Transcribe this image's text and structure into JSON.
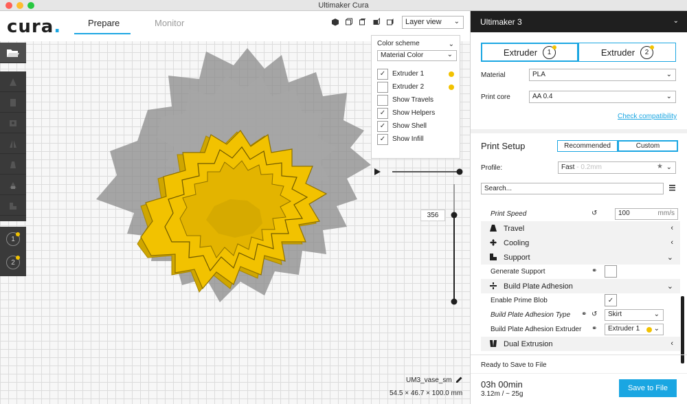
{
  "window": {
    "title": "Ultimaker Cura"
  },
  "header": {
    "logo": "cura",
    "tabs": [
      {
        "label": "Prepare"
      },
      {
        "label": "Monitor"
      }
    ],
    "view_mode": "Layer view"
  },
  "view_icons": [
    "iso-view-icon",
    "front-view-icon",
    "top-view-icon",
    "left-view-icon",
    "right-view-icon"
  ],
  "tools": [
    {
      "name": "open-file-icon"
    },
    {
      "name": "move-tool-icon"
    },
    {
      "name": "scale-tool-icon"
    },
    {
      "name": "rotate-tool-icon"
    },
    {
      "name": "mirror-tool-icon"
    },
    {
      "name": "per-model-settings-icon"
    },
    {
      "name": "support-blocker-icon"
    }
  ],
  "extruder_badges": [
    "1",
    "2"
  ],
  "color_panel": {
    "title": "Color scheme",
    "scheme": "Material Color",
    "options": [
      {
        "label": "Extruder 1",
        "checked": true,
        "dot": true
      },
      {
        "label": "Extruder 2",
        "checked": false,
        "dot": true
      },
      {
        "label": "Show Travels",
        "checked": false,
        "dot": false
      },
      {
        "label": "Show Helpers",
        "checked": true,
        "dot": false
      },
      {
        "label": "Show Shell",
        "checked": true,
        "dot": false
      },
      {
        "label": "Show Infill",
        "checked": true,
        "dot": false
      }
    ]
  },
  "layer": {
    "current": "356"
  },
  "model": {
    "name": "UM3_vase_sm",
    "dimensions": "54.5 × 46.7 × 100.0 mm"
  },
  "sidebar": {
    "machine": "Ultimaker 3",
    "extruders": [
      {
        "label": "Extruder",
        "num": "1"
      },
      {
        "label": "Extruder",
        "num": "2"
      }
    ],
    "material_label": "Material",
    "material_value": "PLA",
    "print_core_label": "Print core",
    "print_core_value": "AA 0.4",
    "check_link": "Check compatibility",
    "print_setup": "Print Setup",
    "modes": [
      "Recommended",
      "Custom"
    ],
    "profile_label": "Profile:",
    "profile_value": "Fast",
    "profile_sub": "- 0.2mm",
    "search_placeholder": "Search...",
    "settings": {
      "print_speed": {
        "label": "Print Speed",
        "value": "100",
        "unit": "mm/s"
      },
      "travel": "Travel",
      "cooling": "Cooling",
      "support": "Support",
      "generate_support": "Generate Support",
      "build_plate_adhesion": "Build Plate Adhesion",
      "enable_prime_blob": "Enable Prime Blob",
      "adhesion_type": {
        "label": "Build Plate Adhesion Type",
        "value": "Skirt"
      },
      "adhesion_extruder": {
        "label": "Build Plate Adhesion Extruder",
        "value": "Extruder 1"
      },
      "dual_extrusion": "Dual Extrusion"
    },
    "status": "Ready to Save to File",
    "time": "03h 00min",
    "material_usage": "3.12m / ~ 25g",
    "save_label": "Save to File"
  },
  "colors": {
    "accent": "#1aa6e2",
    "filament": "#f2c200",
    "dark": "#1f1f1f"
  }
}
